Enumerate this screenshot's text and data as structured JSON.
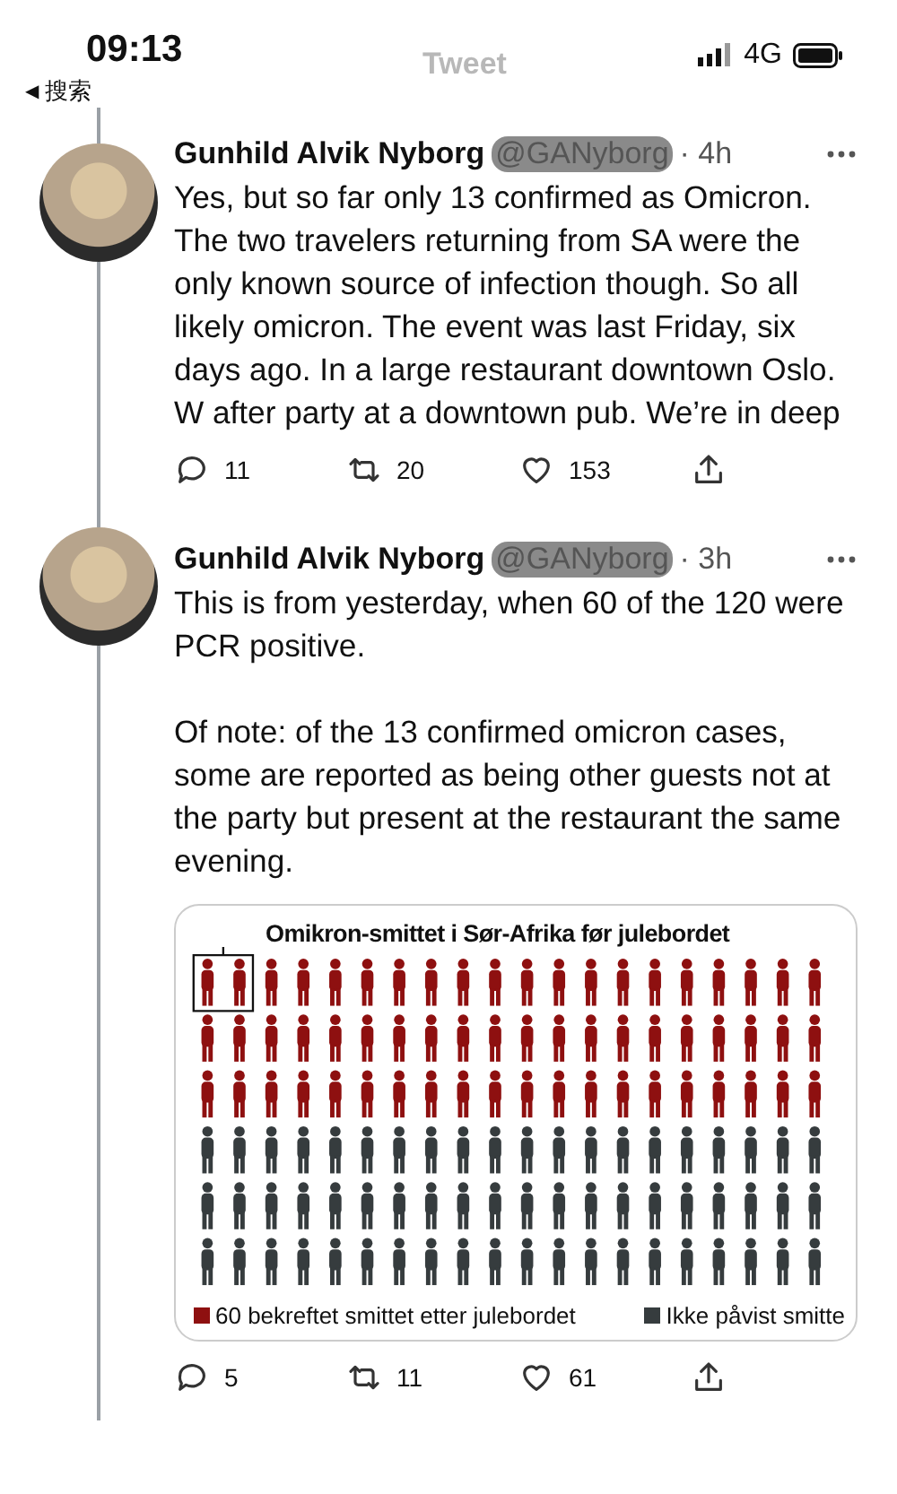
{
  "status_bar": {
    "time": "09:13",
    "network": "4G",
    "back_arrow": "◀",
    "back_label": "搜索",
    "header_title": "Tweet"
  },
  "tweets": [
    {
      "name": "Gunhild Alvik Nyborg",
      "handle": "@GANyborg",
      "meta": "· 4h",
      "paragraphs": [
        "Yes, but so far only 13 confirmed as Omicron. The two travelers returning from SA were the only known source of infection though. So all likely omicron. The event was last Friday, six days ago. In a large restaurant downtown Oslo. W after party at a downtown pub. We’re in deep"
      ],
      "replies": "11",
      "retweets": "20",
      "likes": "153"
    },
    {
      "name": "Gunhild Alvik Nyborg",
      "handle": "@GANyborg",
      "meta": "· 3h",
      "paragraphs": [
        "This is from yesterday, when 60 of the 120 were PCR positive.",
        "Of note: of the 13 confirmed omicron cases, some are reported as being other guests not at the party but present at the restaurant the same evening."
      ],
      "infographic": {
        "title": "Omikron-smittet i Sør-Afrika før julebordet",
        "legend": [
          {
            "label": "60 bekreftet smittet etter julebordet",
            "color": "#8e1010"
          },
          {
            "label": "Ikke påvist smitte",
            "color": "#363c3e"
          }
        ]
      },
      "replies": "5",
      "retweets": "11",
      "likes": "61"
    }
  ]
}
